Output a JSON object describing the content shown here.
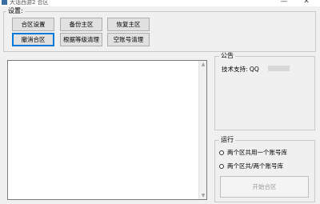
{
  "window": {
    "title": "大话西游2 合区",
    "minimize_label": "—",
    "close_label": "✕"
  },
  "settings": {
    "legend": "设置:",
    "buttons": {
      "merge_settings": "合区设置",
      "backup_main": "备份主区",
      "restore_main": "恢复主区",
      "cancel_merge": "撤消合区",
      "level_cleanup": "根据等级清理",
      "empty_account_cleanup": "空账号清理"
    }
  },
  "log": {
    "scroll_up": "▲",
    "scroll_down": "▼"
  },
  "notice": {
    "legend": "公告",
    "support_text": "技术支持: QQ"
  },
  "run": {
    "legend": "运行",
    "option_shared": "两个区共用一个账号库",
    "option_separate": "两个区共/两个账号库",
    "start_button": "开始合区"
  }
}
